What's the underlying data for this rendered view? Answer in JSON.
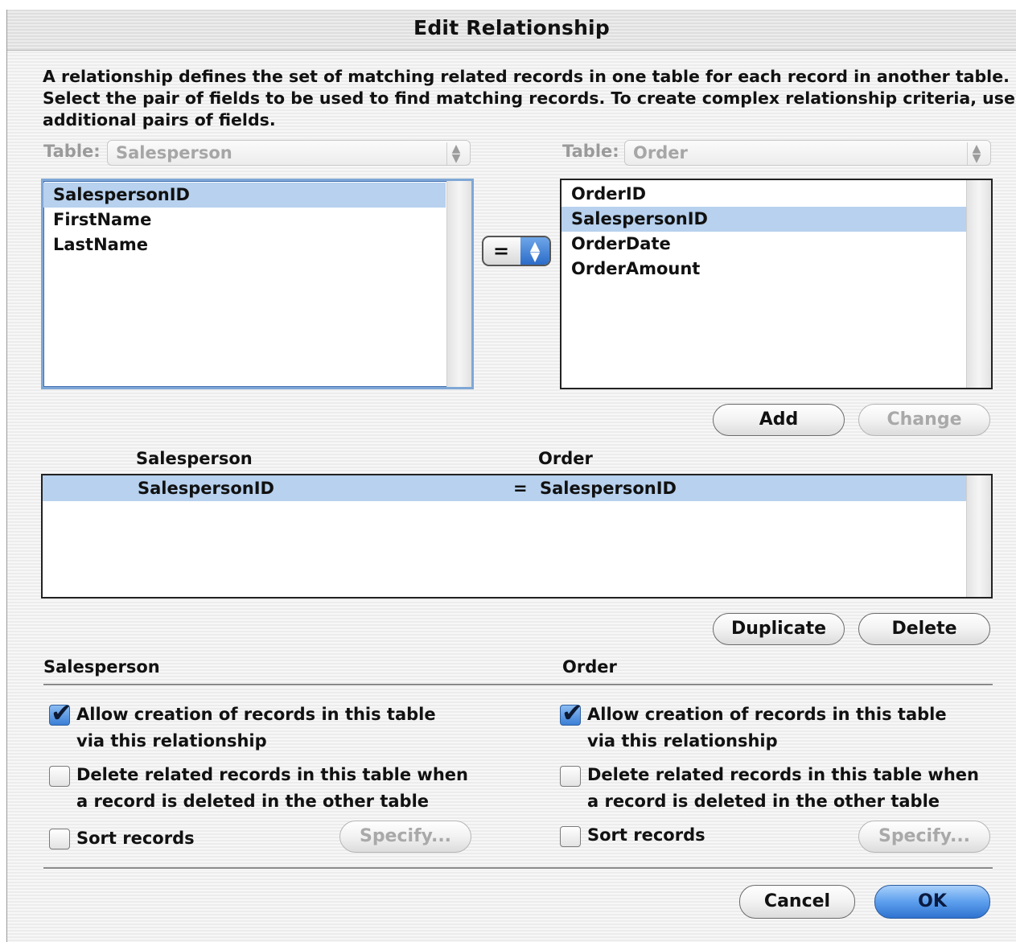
{
  "dialog": {
    "title": "Edit Relationship",
    "description_lines": [
      "A relationship defines the set of matching related records in one table for each record in another table.",
      "Select the pair of fields to be used to find matching records. To create complex relationship criteria, use",
      "additional pairs of fields."
    ]
  },
  "left_table": {
    "label": "Table:",
    "selected": "Salesperson",
    "fields": [
      "SalespersonID",
      "FirstName",
      "LastName"
    ],
    "selected_field": "SalespersonID"
  },
  "right_table": {
    "label": "Table:",
    "selected": "Order",
    "fields": [
      "OrderID",
      "SalespersonID",
      "OrderDate",
      "OrderAmount"
    ],
    "selected_field": "SalespersonID"
  },
  "operator": {
    "value": "="
  },
  "buttons": {
    "add": "Add",
    "change": "Change",
    "duplicate": "Duplicate",
    "delete": "Delete",
    "cancel": "Cancel",
    "ok": "OK",
    "specify": "Specify..."
  },
  "pairs": {
    "header_left": "Salesperson",
    "header_right": "Order",
    "rows": [
      {
        "left": "SalespersonID",
        "op": "=",
        "right": "SalespersonID"
      }
    ]
  },
  "options": {
    "left": {
      "table": "Salesperson",
      "allow_creation": {
        "checked": true,
        "line1": "Allow creation of records in this table",
        "line2": "via this relationship"
      },
      "delete_related": {
        "checked": false,
        "line1": "Delete related records in this table when",
        "line2": "a record is deleted in the other table"
      },
      "sort_records": {
        "checked": false,
        "label": "Sort records"
      }
    },
    "right": {
      "table": "Order",
      "allow_creation": {
        "checked": true,
        "line1": "Allow creation of records in this table",
        "line2": "via this relationship"
      },
      "delete_related": {
        "checked": false,
        "line1": "Delete related records in this table when",
        "line2": "a record is deleted in the other table"
      },
      "sort_records": {
        "checked": false,
        "label": "Sort records"
      }
    }
  },
  "colors": {
    "selection": "#b7d1ee",
    "default_button": "#3d82db",
    "focus_ring": "#7fa7d6"
  }
}
